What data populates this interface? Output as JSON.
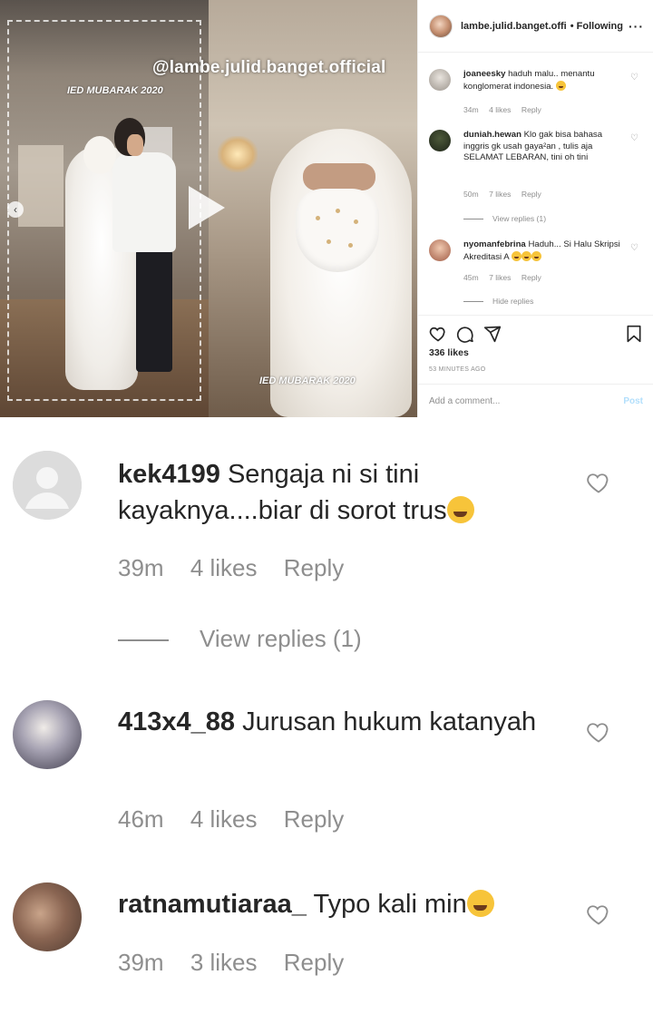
{
  "post": {
    "username": "lambe.julid.banget.offi",
    "follow_status": "• Following",
    "more_icon": "more-horizontal-icon",
    "media": {
      "watermark": "@lambe.julid.banget.official",
      "caption_left": "IED MUBARAK 2020",
      "caption_right": "IED MUBARAK 2020"
    },
    "comments": [
      {
        "user": "joaneesky",
        "text": "haduh malu.. menantu konglomerat indonesia.",
        "emoji": "thinking-face",
        "time": "34m",
        "likes": "4 likes",
        "reply": "Reply"
      },
      {
        "user": "duniah.hewan",
        "text": "Klo gak bisa bahasa inggris gk usah gaya²an , tulis aja SELAMAT LEBARAN, tini oh tini",
        "time": "50m",
        "likes": "7 likes",
        "reply": "Reply",
        "view_replies": "View replies (1)"
      },
      {
        "user": "nyomanfebrina",
        "text": "Haduh... Si Halu Skripsi Akreditasi A",
        "emoji": "grinning-sweat x3",
        "time": "45m",
        "likes": "7 likes",
        "reply": "Reply",
        "hide_replies": "Hide replies"
      }
    ],
    "likes": "336 likes",
    "posted": "53 MINUTES AGO",
    "add_comment_placeholder": "Add a comment...",
    "post_button": "Post"
  },
  "zoomed_comments": [
    {
      "user": "kek4199",
      "text": "Sengaja ni si tini kayaknya....biar di sorot trus",
      "emoji": "laughing-tears",
      "time": "39m",
      "likes": "4 likes",
      "reply": "Reply",
      "view_replies": "View replies (1)"
    },
    {
      "user": "413x4_88",
      "text": "Jurusan hukum katanyah",
      "time": "46m",
      "likes": "4 likes",
      "reply": "Reply"
    },
    {
      "user": "ratnamutiaraa_",
      "text": "Typo kali min",
      "emoji": "grinning-teeth",
      "time": "39m",
      "likes": "3 likes",
      "reply": "Reply"
    }
  ],
  "colors": {
    "text": "#262626",
    "muted": "#8e8e8e",
    "post_disabled": "#b2dffc",
    "border": "#efefef"
  }
}
